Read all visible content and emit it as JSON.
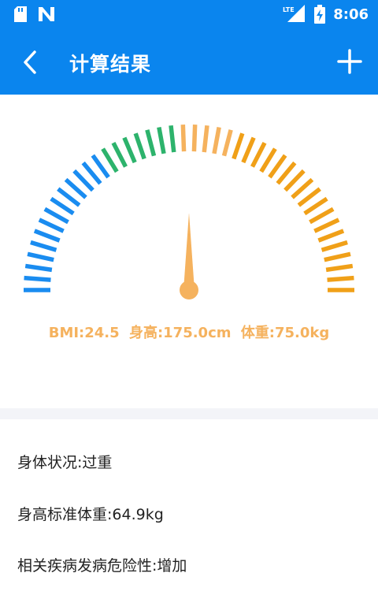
{
  "status_bar": {
    "time": "8:06",
    "network": "LTE",
    "icons": [
      "sd-card-icon",
      "n-notification-icon",
      "lte-signal-icon",
      "battery-charging-icon"
    ]
  },
  "app_bar": {
    "title": "计算结果",
    "back_icon": "chevron-left-icon",
    "action_icon": "plus-icon"
  },
  "gauge": {
    "needle_color": "#f5b25e",
    "segment_colors": [
      "#1a8cf0",
      "#2db36c",
      "#f5b25e",
      "#f0a018"
    ],
    "bmi_position": 0.5
  },
  "readout": {
    "bmi": "BMI:24.5",
    "height": "身高:175.0cm",
    "weight": "体重:75.0kg"
  },
  "results": {
    "status": "身体状况:过重",
    "standard_weight": "身高标准体重:64.9kg",
    "risk": "相关疾病发病危险性:增加"
  },
  "colors": {
    "primary": "#0a85ee",
    "accent": "#f5b25e"
  }
}
